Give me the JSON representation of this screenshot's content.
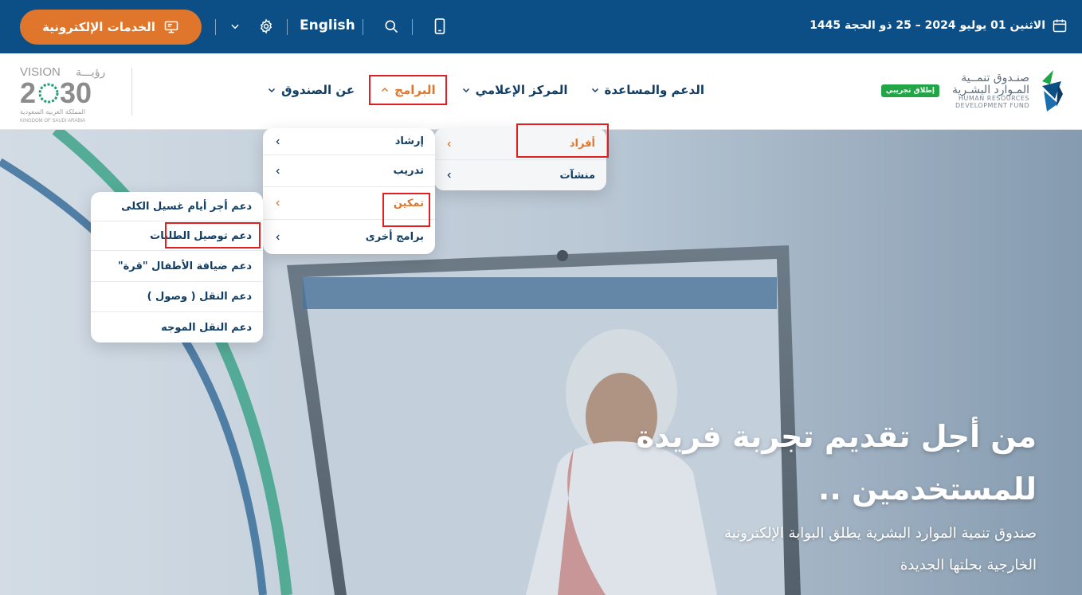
{
  "topbar": {
    "eservices_label": "الخدمات الإلكترونية",
    "language": "English",
    "date": "الاثنين 01 يوليو 2024  –  25 ذو الحجة 1445"
  },
  "header": {
    "vision_logo": {
      "line1": "VISION رؤيـــة",
      "line2": "2030",
      "line3": "المملكة العربية السعودية",
      "line4": "KINGDOM OF SAUDI ARABIA"
    },
    "hrdf_logo": {
      "ar_line1": "صنـدوق تنمــية",
      "ar_line2": "المـوارد البشـرية",
      "en_line1": "HUMAN RESOURCES",
      "en_line2": "DEVELOPMENT FUND",
      "beta_badge": "إطلاق تجريبي"
    },
    "nav": [
      {
        "label": "عن الصندوق",
        "active": false
      },
      {
        "label": "البرامج",
        "active": true
      },
      {
        "label": "المركز الإعلامي",
        "active": false
      },
      {
        "label": "الدعم والمساعدة",
        "active": false
      }
    ]
  },
  "menu": {
    "level1": [
      {
        "label": "أفراد",
        "highlighted": true
      },
      {
        "label": "منشآت",
        "highlighted": false
      }
    ],
    "level2": [
      {
        "label": "إرشاد",
        "highlighted": false
      },
      {
        "label": "تدريب",
        "highlighted": false
      },
      {
        "label": "تمكين",
        "highlighted": true
      },
      {
        "label": "برامج أخرى",
        "highlighted": false
      }
    ],
    "level3": [
      {
        "label": "دعم أجر أيام غسيل الكلى"
      },
      {
        "label": "دعم توصيل الطلبات"
      },
      {
        "label": "دعم ضيافة الأطفال \"قرة\""
      },
      {
        "label": "دعم النقل ( وصول )"
      },
      {
        "label": "دعم النقل الموجه"
      }
    ]
  },
  "hero": {
    "title_line1": "من أجل تقديم تجربة فريدة",
    "title_line2": "للمستخدمين ..",
    "subtitle_line1": "صندوق تنمية الموارد البشرية يطلق البوابة الإلكترونية",
    "subtitle_line2": "الخارجية بحلتها الجديدة"
  },
  "colors": {
    "topbar_bg": "#0c4f86",
    "accent_orange": "#e0762b",
    "nav_text": "#123d63",
    "highlight_box": "#e02020",
    "beta_green": "#22a547"
  }
}
